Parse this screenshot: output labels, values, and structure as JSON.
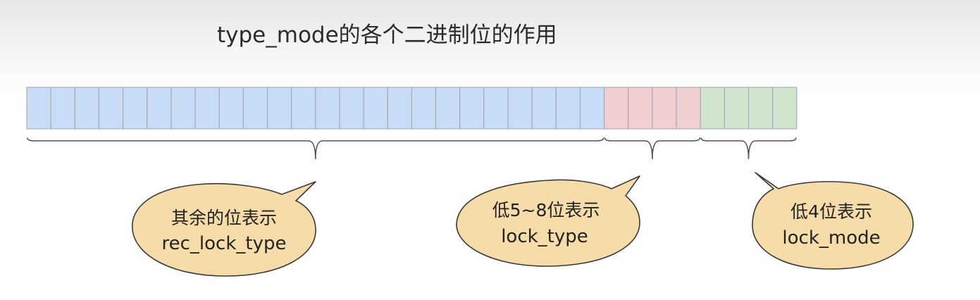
{
  "title": "type_mode的各个二进制位的作用",
  "bit_groups": [
    {
      "name": "rec_lock_type",
      "bits": 24,
      "color": "#c8dcf8"
    },
    {
      "name": "lock_type",
      "bits": 4,
      "color": "#f2d0d2"
    },
    {
      "name": "lock_mode",
      "bits": 4,
      "color": "#cfe5cc"
    }
  ],
  "callouts": [
    {
      "line1": "其余的位表示",
      "line2": "rec_lock_type"
    },
    {
      "line1": "低5~8位表示",
      "line2": "lock_type"
    },
    {
      "line1": "低4位表示",
      "line2": "lock_mode"
    }
  ],
  "colors": {
    "cell_border": "#9aa4ad",
    "bubble_fill": "#f6dca9",
    "bubble_stroke": "#3a3a3a",
    "brace": "#555555"
  }
}
